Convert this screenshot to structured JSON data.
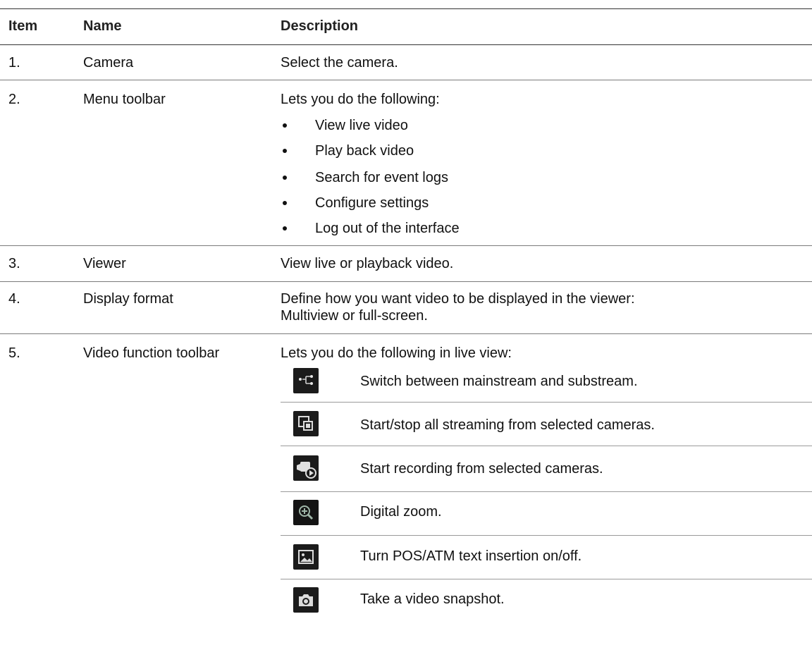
{
  "header": {
    "item": "Item",
    "name": "Name",
    "description": "Description"
  },
  "rows": [
    {
      "item": "1.",
      "name": "Camera",
      "description": "Select the camera."
    },
    {
      "item": "2.",
      "name": "Menu toolbar",
      "description": "Lets you do the following:",
      "bullets": [
        "View live video",
        "Play back video",
        "Search for event logs",
        "Configure settings",
        "Log out of the interface"
      ]
    },
    {
      "item": "3.",
      "name": "Viewer",
      "description": "View live or playback video."
    },
    {
      "item": "4.",
      "name": "Display format",
      "description": "Define how you want video to be displayed in the viewer:",
      "description_line2": "Multiview or full-screen."
    },
    {
      "item": "5.",
      "name": "Video function toolbar",
      "description": "Lets you do the following in live view:",
      "functions": [
        {
          "icon": "stream-switch-icon",
          "text": "Switch between mainstream and substream."
        },
        {
          "icon": "start-stop-streaming-icon",
          "text": "Start/stop all streaming from selected cameras."
        },
        {
          "icon": "record-camera-icon",
          "text": "Start recording from selected cameras."
        },
        {
          "icon": "digital-zoom-icon",
          "text": "Digital zoom."
        },
        {
          "icon": "image-insertion-icon",
          "text": "Turn POS/ATM text insertion on/off."
        },
        {
          "icon": "snapshot-camera-icon",
          "text": "Take a video snapshot."
        }
      ]
    }
  ]
}
